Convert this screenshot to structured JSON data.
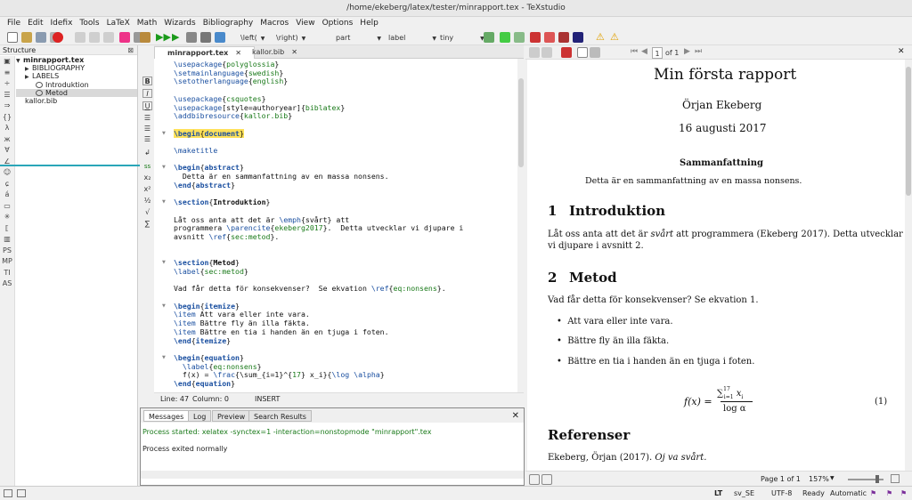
{
  "window": {
    "title": "/home/ekeberg/latex/tester/minrapport.tex - TeXstudio"
  },
  "menu": [
    "File",
    "Edit",
    "Idefix",
    "Tools",
    "LaTeX",
    "Math",
    "Wizards",
    "Bibliography",
    "Macros",
    "View",
    "Options",
    "Help"
  ],
  "toolbar": {
    "left_delim": "\\left(",
    "right_delim": "\\right)",
    "sectioning": "part",
    "reference": "label",
    "size": "tiny"
  },
  "structure": {
    "title": "Structure",
    "items": [
      {
        "label": "minrapport.tex",
        "level": 0,
        "bold": true
      },
      {
        "label": "BIBLIOGRAPHY",
        "level": 1
      },
      {
        "label": "LABELS",
        "level": 1
      },
      {
        "label": "Introduktion",
        "level": 2
      },
      {
        "label": "Metod",
        "level": 2,
        "selected": true
      },
      {
        "label": "kallor.bib",
        "level": 0
      }
    ]
  },
  "tabs": [
    {
      "label": "minrapport.tex",
      "active": true
    },
    {
      "label": "kallor.bib",
      "active": false
    }
  ],
  "code": [
    "\\usepackage{polyglossia}",
    "\\setmainlanguage{swedish}",
    "\\setotherlanguage{english}",
    "",
    "\\usepackage{csquotes}",
    "\\usepackage[style=authoryear]{biblatex}",
    "\\addbibresource{kallor.bib}",
    "",
    "\\begin{document}",
    "",
    "\\maketitle",
    "",
    "\\begin{abstract}",
    "  Detta är en sammanfattning av en massa nonsens.",
    "\\end{abstract}",
    "",
    "\\section{Introduktion}",
    "",
    "Låt oss anta att det är \\emph{svårt} att",
    "programmera \\parencite{ekeberg2017}.  Detta utvecklar vi djupare i",
    "avsnitt \\ref{sec:metod}.",
    "",
    "",
    "\\section{Metod}",
    "\\label{sec:metod}",
    "",
    "Vad får detta för konsekvenser?  Se ekvation \\ref{eq:nonsens}.",
    "",
    "\\begin{itemize}",
    "\\item Att vara eller inte vara.",
    "\\item Bättre fly än illa fäkta.",
    "\\item Bättre en tia i handen än en tjuga i foten.",
    "\\end{itemize}",
    "",
    "\\begin{equation}",
    "  \\label{eq:nonsens}",
    "  f(x) = \\frac{\\sum_{i=1}^{17} x_i}{\\log \\alpha}",
    "\\end{equation}"
  ],
  "editor_status": {
    "line": "Line: 47",
    "column": "Column: 0",
    "mode": "INSERT"
  },
  "messages": {
    "tabs": [
      "Messages",
      "Log",
      "Preview",
      "Search Results"
    ],
    "started": "Process started: xelatex -synctex=1 -interaction=nonstopmode \"minrapport\".tex",
    "exited": "Process exited normally"
  },
  "pdf": {
    "page_indicator": "1",
    "page_of": "of 1",
    "title": "Min första rapport",
    "author": "Örjan Ekeberg",
    "date": "16 augusti 2017",
    "abstract_heading": "Sammanfattning",
    "abstract": "Detta är en sammanfattning av en massa nonsens.",
    "section1_num": "1",
    "section1": "Introduktion",
    "para1_line1": "Låt oss anta att det är svårt att programmera (Ekeberg 2017). Detta utvecklar",
    "para1_line2": "vi djupare i avsnitt 2.",
    "section2_num": "2",
    "section2": "Metod",
    "para2": "Vad får detta för konsekvenser? Se ekvation 1.",
    "bullets": [
      "Att vara eller inte vara.",
      "Bättre fly än illa fäkta.",
      "Bättre en tia i handen än en tjuga i foten."
    ],
    "eq_lhs": "f(x) =",
    "eq_num_top": "∑",
    "eq_num_sup": "17",
    "eq_num_sub": "i=1",
    "eq_num_var": "x",
    "eq_num_varsub": "i",
    "eq_den": "log α",
    "eq_label": "(1)",
    "references_heading": "Referenser",
    "reference": "Ekeberg, Örjan (2017). Oj va svårt."
  },
  "pdf_status": {
    "page": "Page 1 of 1",
    "zoom": "157%"
  },
  "statusbar": {
    "language": "sv_SE",
    "encoding": "UTF-8",
    "state": "Ready",
    "mode": "Automatic"
  }
}
